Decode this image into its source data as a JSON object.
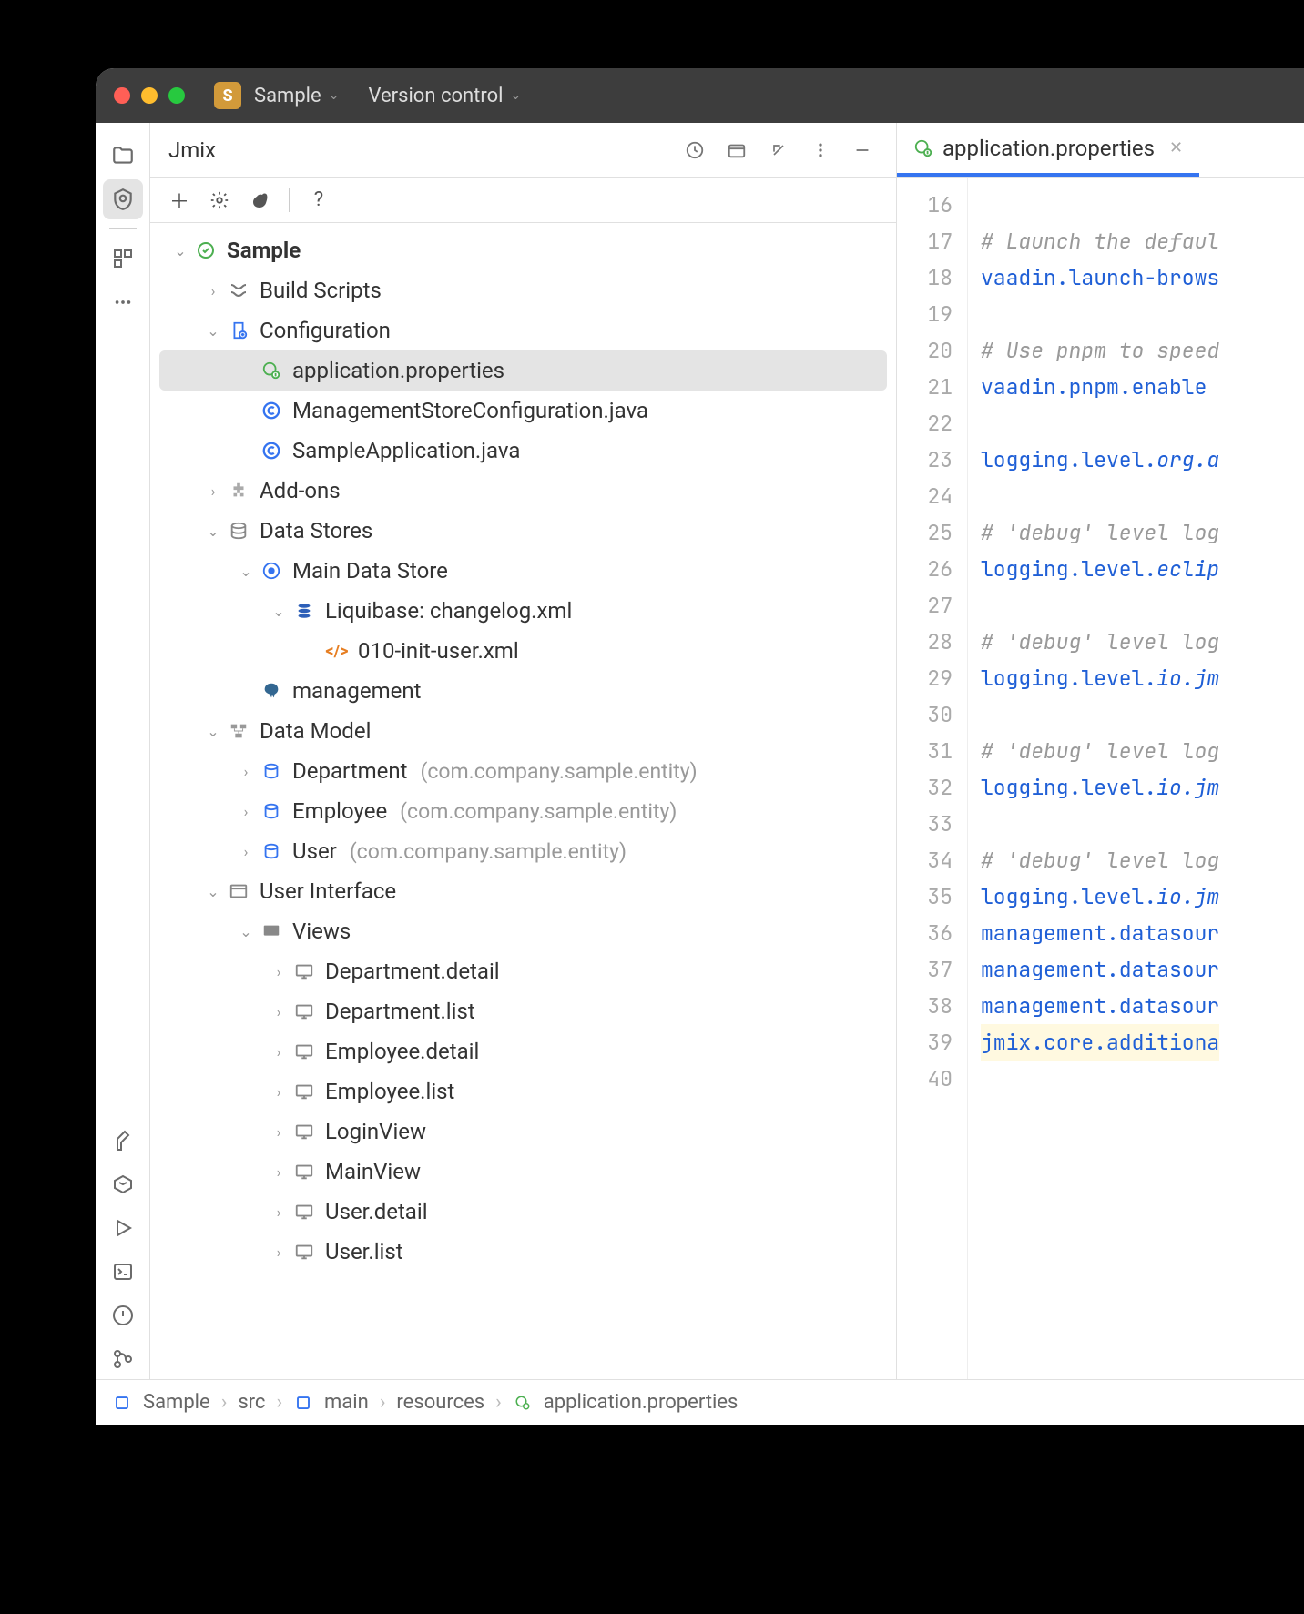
{
  "titlebar": {
    "project_badge": "S",
    "project_name": "Sample",
    "vcs_label": "Version control"
  },
  "panel": {
    "title": "Jmix"
  },
  "tree": {
    "root": "Sample",
    "build_scripts": "Build Scripts",
    "configuration": "Configuration",
    "app_props": "application.properties",
    "mgmt_store_cfg": "ManagementStoreConfiguration.java",
    "sample_app": "SampleApplication.java",
    "addons": "Add-ons",
    "data_stores": "Data Stores",
    "main_data_store": "Main Data Store",
    "liquibase": "Liquibase: changelog.xml",
    "init_user": "010-init-user.xml",
    "management": "management",
    "data_model": "Data Model",
    "entity_department": "Department",
    "entity_employee": "Employee",
    "entity_user": "User",
    "entity_pkg": "(com.company.sample.entity)",
    "user_interface": "User Interface",
    "views": "Views",
    "view_dept_detail": "Department.detail",
    "view_dept_list": "Department.list",
    "view_emp_detail": "Employee.detail",
    "view_emp_list": "Employee.list",
    "view_login": "LoginView",
    "view_main": "MainView",
    "view_user_detail": "User.detail",
    "view_user_list": "User.list"
  },
  "editor": {
    "tab_name": "application.properties",
    "lines": [
      {
        "n": 16,
        "type": "blank",
        "text": ""
      },
      {
        "n": 17,
        "type": "comment",
        "text": "# Launch the defaul"
      },
      {
        "n": 18,
        "type": "key",
        "text": "vaadin.launch-brows"
      },
      {
        "n": 19,
        "type": "blank",
        "text": ""
      },
      {
        "n": 20,
        "type": "comment",
        "text": "# Use pnpm to speed"
      },
      {
        "n": 21,
        "type": "key",
        "text": "vaadin.pnpm.enable"
      },
      {
        "n": 22,
        "type": "blank",
        "text": ""
      },
      {
        "n": 23,
        "type": "key-mixed",
        "prefix": "logging.level.",
        "italic": "org.a"
      },
      {
        "n": 24,
        "type": "blank",
        "text": ""
      },
      {
        "n": 25,
        "type": "comment",
        "text": "# 'debug' level log"
      },
      {
        "n": 26,
        "type": "key-mixed",
        "prefix": "logging.level.",
        "italic": "eclip"
      },
      {
        "n": 27,
        "type": "blank",
        "text": ""
      },
      {
        "n": 28,
        "type": "comment",
        "text": "# 'debug' level log"
      },
      {
        "n": 29,
        "type": "key-mixed",
        "prefix": "logging.level.",
        "italic": "io.jm"
      },
      {
        "n": 30,
        "type": "blank",
        "text": ""
      },
      {
        "n": 31,
        "type": "comment",
        "text": "# 'debug' level log"
      },
      {
        "n": 32,
        "type": "key-mixed",
        "prefix": "logging.level.",
        "italic": "io.jm"
      },
      {
        "n": 33,
        "type": "blank",
        "text": ""
      },
      {
        "n": 34,
        "type": "comment",
        "text": "# 'debug' level log"
      },
      {
        "n": 35,
        "type": "key-mixed",
        "prefix": "logging.level.",
        "italic": "io.jm"
      },
      {
        "n": 36,
        "type": "key",
        "text": "management.datasour"
      },
      {
        "n": 37,
        "type": "key",
        "text": "management.datasour"
      },
      {
        "n": 38,
        "type": "key",
        "text": "management.datasour"
      },
      {
        "n": 39,
        "type": "key-hl",
        "text": "jmix.core.additiona"
      },
      {
        "n": 40,
        "type": "blank",
        "text": ""
      }
    ]
  },
  "breadcrumb": {
    "items": [
      "Sample",
      "src",
      "main",
      "resources",
      "application.properties"
    ]
  }
}
